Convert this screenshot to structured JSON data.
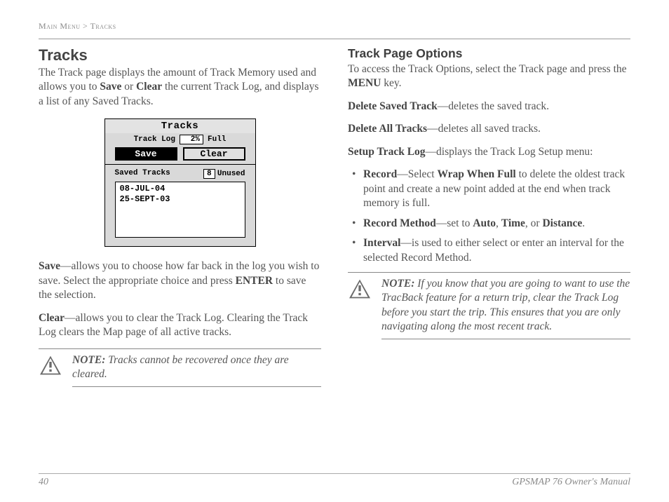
{
  "breadcrumb": {
    "a": "Main Menu",
    "b": "Tracks"
  },
  "left": {
    "heading": "Tracks",
    "intro1": "The Track page displays the amount of Track Memory used and allows you to ",
    "intro_save": "Save",
    "intro_mid": " or ",
    "intro_clear": "Clear",
    "intro2": " the current Track Log, and displays a list of any Saved Tracks.",
    "save_label": "Save",
    "save_desc": "—allows you to choose how far back in the log you wish to save. Select the appropriate choice and press ",
    "save_enter": "ENTER",
    "save_desc2": " to save the selection.",
    "clear_label": "Clear",
    "clear_desc": "—allows you to clear the Track Log. Clearing the Track Log clears the Map page of all active tracks.",
    "note_label": "NOTE:",
    "note_text": " Tracks cannot be recovered once they are cleared."
  },
  "device": {
    "title": "Tracks",
    "tracklog_label": "Track Log",
    "percent": "2%",
    "full_label": "Full",
    "save_btn": "Save",
    "clear_btn": "Clear",
    "saved_label": "Saved Tracks",
    "unused_val": "8",
    "unused_label": "Unused",
    "item1": "08-JUL-04",
    "item2": "25-SEPT-03"
  },
  "right": {
    "heading": "Track Page Options",
    "intro1": "To access the Track Options, select the Track page and press the ",
    "intro_menu": "MENU",
    "intro2": " key.",
    "opt1_label": "Delete Saved Track",
    "opt1_desc": "—deletes the saved track.",
    "opt2_label": "Delete All Tracks",
    "opt2_desc": "—deletes all saved tracks.",
    "opt3_label": "Setup Track Log",
    "opt3_desc": "—displays the Track Log Setup menu:",
    "b1_label": "Record",
    "b1_mid": "—Select ",
    "b1_wrap": "Wrap When Full",
    "b1_desc": " to delete the oldest track point and create a new point added at the end when track memory is full.",
    "b2_label": "Record Method",
    "b2_mid": "—set to ",
    "b2_auto": "Auto",
    "b2_c1": ", ",
    "b2_time": "Time",
    "b2_c2": ", or ",
    "b2_dist": "Distance",
    "b2_end": ".",
    "b3_label": "Interval",
    "b3_desc": "—is used to either select or enter an interval for the selected Record Method.",
    "note_label": "NOTE:",
    "note_text": " If you know that you are going to want to use the TracBack feature for a return trip, clear the Track Log before you start the trip. This ensures that you are only navigating along the most recent track."
  },
  "footer": {
    "page": "40",
    "title": "GPSMAP 76 Owner's Manual"
  }
}
